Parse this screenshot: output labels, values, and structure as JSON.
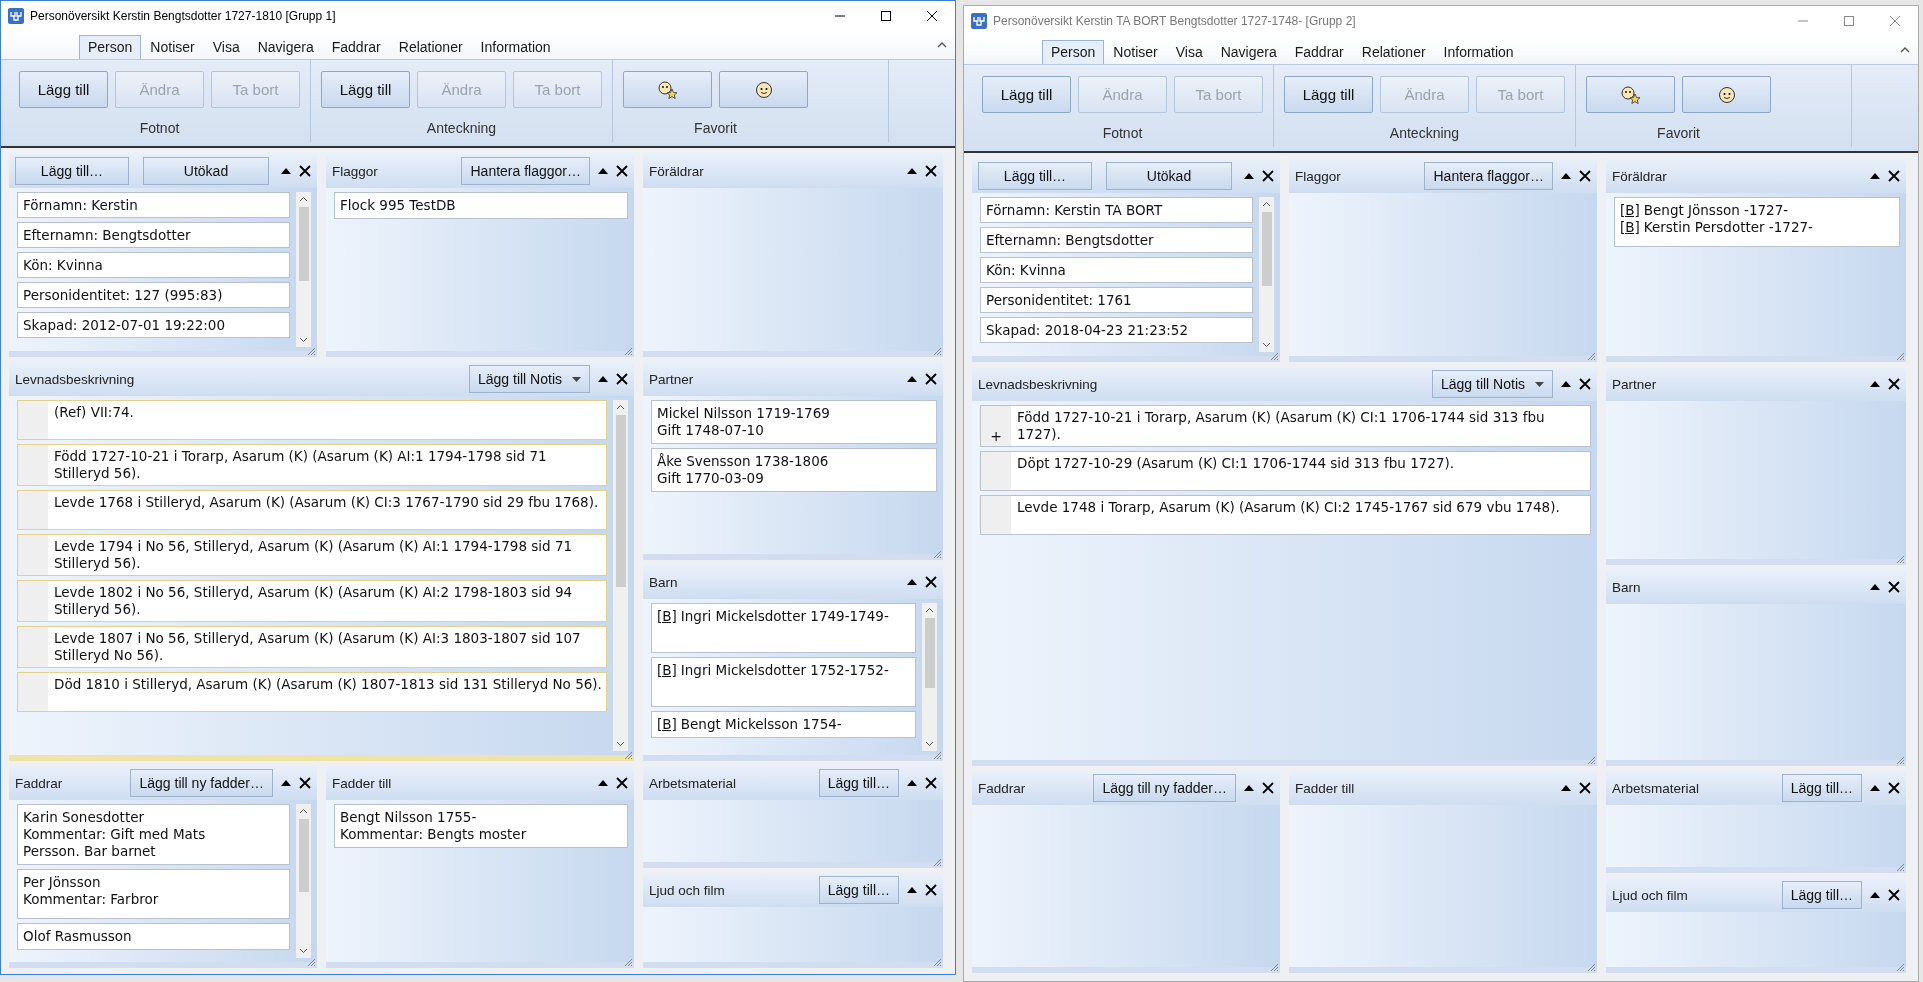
{
  "windows": [
    {
      "title": "Personöversikt Kerstin Bengtsdotter 1727-1810 [Grupp 1]",
      "active": true,
      "tabs": [
        {
          "label": "Person",
          "selected": true
        },
        {
          "label": "Notiser",
          "selected": false
        },
        {
          "label": "Visa",
          "selected": false
        },
        {
          "label": "Navigera",
          "selected": false
        },
        {
          "label": "Faddrar",
          "selected": false
        },
        {
          "label": "Relationer",
          "selected": false
        },
        {
          "label": "Information",
          "selected": false
        }
      ],
      "ribbon": [
        {
          "label": "Fotnot",
          "buttons": [
            {
              "kind": "text",
              "label": "Lägg till",
              "disabled": false
            },
            {
              "kind": "text",
              "label": "Ändra",
              "disabled": true
            },
            {
              "kind": "text",
              "label": "Ta bort",
              "disabled": true
            }
          ]
        },
        {
          "label": "Anteckning",
          "buttons": [
            {
              "kind": "text",
              "label": "Lägg till",
              "disabled": false
            },
            {
              "kind": "text",
              "label": "Ändra",
              "disabled": true
            },
            {
              "kind": "text",
              "label": "Ta bort",
              "disabled": true
            }
          ]
        },
        {
          "label": "Favorit",
          "buttons": [
            {
              "kind": "star-face"
            },
            {
              "kind": "face"
            }
          ]
        }
      ],
      "panels": [
        {
          "kind": "fields",
          "buttons": [
            {
              "label": "Lägg till…"
            },
            {
              "label": "Utökad"
            }
          ],
          "scrollable": true,
          "items": [
            "Förnamn: Kerstin",
            "Efternamn: Bengtsdotter",
            "Kön: Kvinna",
            "Personidentitet: 127 (995:83)",
            "Skapad: 2012-07-01 19:22:00"
          ]
        },
        {
          "kind": "list",
          "title": "Flaggor",
          "buttons": [
            {
              "label": "Hantera flaggor…"
            }
          ],
          "items": [
            {
              "lines": [
                {
                  "text": "Flock 995 TestDB"
                }
              ]
            }
          ]
        },
        {
          "kind": "list",
          "title": "Föräldrar"
        },
        {
          "kind": "notes",
          "title": "Levnadsbeskrivning",
          "buttons": [
            {
              "label": "Lägg till Notis",
              "dropdown": true
            }
          ],
          "focused": true,
          "scrollable": true,
          "items": [
            {
              "text": "(Ref) VII:74."
            },
            {
              "text": "Född 1727-10-21 i Torarp, Asarum (K) (Asarum (K) AI:1 1794-1798 sid 71 Stilleryd 56)."
            },
            {
              "text": "Levde 1768 i Stilleryd, Asarum (K) (Asarum (K) CI:3 1767-1790 sid  29 fbu 1768)."
            },
            {
              "text": "Levde 1794 i No 56, Stilleryd, Asarum (K) (Asarum (K) AI:1 1794-1798 sid  71 Stilleryd 56)."
            },
            {
              "text": "Levde 1802 i No 56, Stilleryd, Asarum (K) (Asarum (K) AI:2 1798-1803 sid  94 Stilleryd 56)."
            },
            {
              "text": "Levde 1807 i No 56, Stilleryd, Asarum (K) (Asarum (K) AI:3 1803-1807 sid  107 Stilleryd No 56)."
            },
            {
              "text": "Död 1810 i Stilleryd, Asarum (K) (Asarum (K) 1807-1813 sid  131 Stilleryd No 56)."
            }
          ]
        },
        {
          "kind": "list",
          "title": "Partner",
          "items": [
            {
              "lines": [
                {
                  "text": "Mickel Nilsson 1719-1769"
                },
                {
                  "text": "Gift 1748-07-10"
                }
              ]
            },
            {
              "lines": [
                {
                  "text": "Åke Svensson 1738-1806"
                },
                {
                  "text": "Gift 1770-03-09"
                }
              ]
            }
          ]
        },
        {
          "kind": "list",
          "title": "Barn",
          "scrollable": true,
          "items": [
            {
              "tall": true,
              "lines": [
                {
                  "link": "[B]",
                  "text": "Ingri Mickelsdotter 1749-1749-"
                }
              ]
            },
            {
              "tall": true,
              "lines": [
                {
                  "link": "[B]",
                  "text": "Ingri Mickelsdotter 1752-1752-"
                }
              ]
            },
            {
              "lines": [
                {
                  "link": "[B]",
                  "text": "Bengt Mickelsson 1754-"
                }
              ]
            }
          ]
        },
        {
          "kind": "list",
          "title": "Faddrar",
          "buttons": [
            {
              "label": "Lägg till ny fadder…"
            }
          ],
          "scrollable": true,
          "items": [
            {
              "lines": [
                {
                  "text": "Karin Sonesdotter"
                },
                {
                  "text": "Kommentar: Gift med Mats"
                },
                {
                  "text": "Persson. Bar barnet"
                }
              ]
            },
            {
              "tall": true,
              "lines": [
                {
                  "text": "Per Jönsson"
                },
                {
                  "text": "Kommentar: Farbror"
                }
              ]
            },
            {
              "lines": [
                {
                  "text": "Olof Rasmusson"
                }
              ]
            }
          ]
        },
        {
          "kind": "list",
          "title": "Fadder till",
          "items": [
            {
              "lines": [
                {
                  "text": "Bengt Nilsson 1755-"
                },
                {
                  "text": "Kommentar: Bengts moster"
                }
              ]
            }
          ]
        },
        {
          "kind": "list",
          "title": "Arbetsmaterial",
          "buttons": [
            {
              "label": "Lägg till…"
            }
          ]
        },
        {
          "kind": "list",
          "title": "Ljud och film",
          "buttons": [
            {
              "label": "Lägg till…"
            }
          ]
        }
      ]
    },
    {
      "title": "Personöversikt Kerstin TA BORT Bengtsdotter 1727-1748- [Grupp 2]",
      "active": false,
      "tabs": [
        {
          "label": "Person",
          "selected": true
        },
        {
          "label": "Notiser",
          "selected": false
        },
        {
          "label": "Visa",
          "selected": false
        },
        {
          "label": "Navigera",
          "selected": false
        },
        {
          "label": "Faddrar",
          "selected": false
        },
        {
          "label": "Relationer",
          "selected": false
        },
        {
          "label": "Information",
          "selected": false
        }
      ],
      "ribbon": [
        {
          "label": "Fotnot",
          "buttons": [
            {
              "kind": "text",
              "label": "Lägg till",
              "disabled": false
            },
            {
              "kind": "text",
              "label": "Ändra",
              "disabled": true
            },
            {
              "kind": "text",
              "label": "Ta bort",
              "disabled": true
            }
          ]
        },
        {
          "label": "Anteckning",
          "buttons": [
            {
              "kind": "text",
              "label": "Lägg till",
              "disabled": false
            },
            {
              "kind": "text",
              "label": "Ändra",
              "disabled": true
            },
            {
              "kind": "text",
              "label": "Ta bort",
              "disabled": true
            }
          ]
        },
        {
          "label": "Favorit",
          "buttons": [
            {
              "kind": "star-face"
            },
            {
              "kind": "face"
            }
          ]
        }
      ],
      "panels": [
        {
          "kind": "fields",
          "buttons": [
            {
              "label": "Lägg till…"
            },
            {
              "label": "Utökad"
            }
          ],
          "scrollable": true,
          "items": [
            "Förnamn: Kerstin TA BORT",
            "Efternamn: Bengtsdotter",
            "Kön: Kvinna",
            "Personidentitet: 1761",
            "Skapad: 2018-04-23 21:23:52"
          ]
        },
        {
          "kind": "list",
          "title": "Flaggor",
          "buttons": [
            {
              "label": "Hantera flaggor…"
            }
          ]
        },
        {
          "kind": "list",
          "title": "Föräldrar",
          "items": [
            {
              "tall": true,
              "lines": [
                {
                  "link": "[B]",
                  "text": "Bengt Jönsson -1727-"
                },
                {
                  "link": "[B]",
                  "text": "Kerstin Persdotter -1727-"
                }
              ]
            }
          ]
        },
        {
          "kind": "notes",
          "title": "Levnadsbeskrivning",
          "buttons": [
            {
              "label": "Lägg till Notis",
              "dropdown": true
            }
          ],
          "focused": false,
          "items": [
            {
              "text": "Född 1727-10-21 i Torarp, Asarum (K) (Asarum (K) CI:1 1706-1744 sid 313 fbu 1727).",
              "marker": "+"
            },
            {
              "text": "Döpt 1727-10-29 (Asarum (K) CI:1 1706-1744 sid  313 fbu 1727)."
            },
            {
              "text": "Levde 1748 i Torarp, Asarum (K) (Asarum (K) CI:2 1745-1767 sid  679 vbu 1748)."
            }
          ]
        },
        {
          "kind": "list",
          "title": "Partner"
        },
        {
          "kind": "list",
          "title": "Barn"
        },
        {
          "kind": "list",
          "title": "Faddrar",
          "buttons": [
            {
              "label": "Lägg till ny fadder…"
            }
          ]
        },
        {
          "kind": "list",
          "title": "Fadder till"
        },
        {
          "kind": "list",
          "title": "Arbetsmaterial",
          "buttons": [
            {
              "label": "Lägg till…"
            }
          ]
        },
        {
          "kind": "list",
          "title": "Ljud och film",
          "buttons": [
            {
              "label": "Lägg till…"
            }
          ]
        }
      ]
    }
  ]
}
